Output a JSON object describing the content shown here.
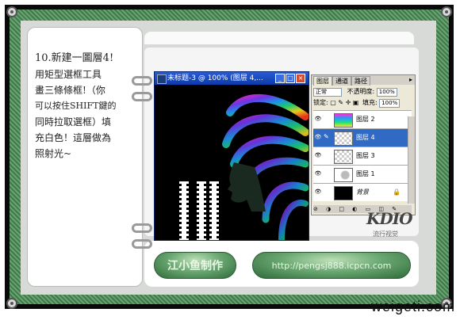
{
  "tutorial": {
    "instruction_lines": [
      "10.新建一圖層4!",
      "用矩型選框工具",
      "畫三條條框!（你",
      "可以按住SHIFT鍵的",
      "同時拉取選框）填",
      "充白色！這層做為",
      "照射光~"
    ]
  },
  "document_window": {
    "title": "未标题-3 @ 100% (图层 4,...",
    "min_symbol": "_",
    "max_symbol": "□",
    "close_symbol": "×"
  },
  "layers_panel": {
    "tabs": [
      "图层",
      "通道",
      "路径"
    ],
    "blend_mode": "正常",
    "opacity_label": "不透明度:",
    "opacity_value": "100%",
    "lock_label": "锁定:",
    "fill_label": "填充:",
    "fill_value": "100%",
    "layers": [
      {
        "name": "图层 2",
        "active": false,
        "thumb": "rainbow"
      },
      {
        "name": "图层 4",
        "active": true,
        "thumb": "transparent"
      },
      {
        "name": "图层 3",
        "active": false,
        "thumb": "figure"
      },
      {
        "name": "图层 1",
        "active": false,
        "thumb": "figure"
      },
      {
        "name": "背景",
        "active": false,
        "thumb": "black",
        "locked": true
      }
    ],
    "bottom_icons": "⊘ ◑ □ ◐ ▭ ◫ ✎"
  },
  "buttons": {
    "author": "江小鱼制作",
    "url": "http://pengsj888.icpcn.com"
  },
  "logo": {
    "main": "KDIO",
    "sub": "流行视觉"
  },
  "watermark": "weigeti.com",
  "colors": {
    "frame": "#4f8a59",
    "active_layer": "#316ac5",
    "title_bar": "#0a3aa8"
  }
}
